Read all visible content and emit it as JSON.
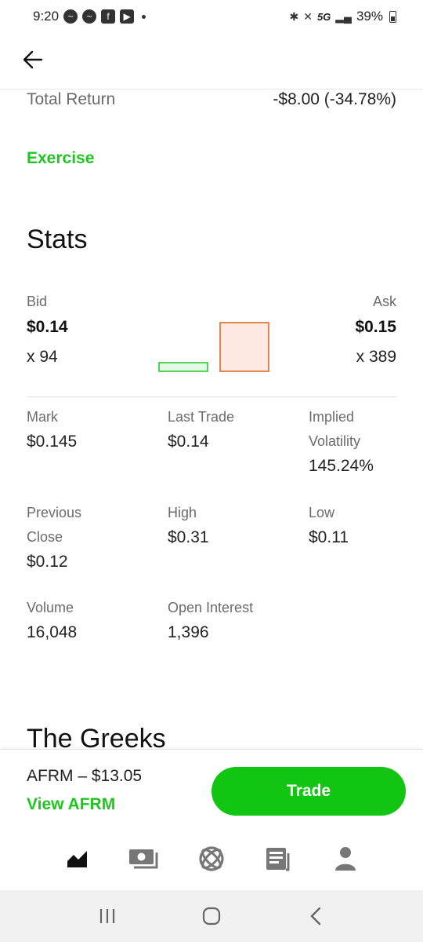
{
  "status_bar": {
    "time": "9:20",
    "network": "5G",
    "battery": "39%"
  },
  "summary": {
    "total_return_label": "Total Return",
    "total_return_value": "-$8.00 (-34.78%)",
    "exercise_label": "Exercise"
  },
  "stats": {
    "title": "Stats",
    "bid": {
      "label": "Bid",
      "price": "$0.14",
      "size": "x 94"
    },
    "ask": {
      "label": "Ask",
      "price": "$0.15",
      "size": "x 389"
    },
    "bid_ask_chart": {
      "bid_size": 94,
      "ask_size": 389,
      "bid_color": "#1ec71e",
      "ask_color": "#d9601c"
    },
    "items": [
      {
        "label": "Mark",
        "value": "$0.145"
      },
      {
        "label": "Last Trade",
        "value": "$0.14"
      },
      {
        "label": "Implied Volatility",
        "value": "145.24%"
      },
      {
        "label": "Previous Close",
        "value": "$0.12"
      },
      {
        "label": "High",
        "value": "$0.31"
      },
      {
        "label": "Low",
        "value": "$0.11"
      },
      {
        "label": "Volume",
        "value": "16,048"
      },
      {
        "label": "Open Interest",
        "value": "1,396"
      }
    ]
  },
  "greeks": {
    "title": "The Greeks"
  },
  "trade_bar": {
    "ticker_price": "AFRM – $13.05",
    "view_link": "View AFRM",
    "trade_button": "Trade"
  },
  "nav": {
    "items": [
      "investing-icon",
      "money-icon",
      "crypto-icon",
      "news-icon",
      "profile-icon"
    ]
  },
  "colors": {
    "accent_green": "#1ec71e",
    "button_green": "#13c513",
    "ask_orange": "#d9601c"
  }
}
